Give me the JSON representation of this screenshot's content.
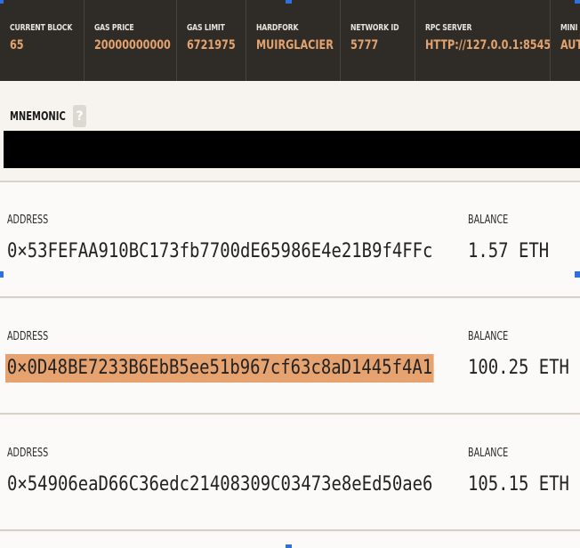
{
  "statusbar": {
    "items": [
      {
        "label": "CURRENT BLOCK",
        "value": "65"
      },
      {
        "label": "GAS PRICE",
        "value": "20000000000"
      },
      {
        "label": "GAS LIMIT",
        "value": "6721975"
      },
      {
        "label": "HARDFORK",
        "value": "MUIRGLACIER"
      },
      {
        "label": "NETWORK ID",
        "value": "5777"
      },
      {
        "label": "RPC SERVER",
        "value": "HTTP://127.0.0.1:8545"
      },
      {
        "label": "MINI",
        "value": "AUT"
      }
    ]
  },
  "mnemonic": {
    "label": "MNEMONIC",
    "help_icon": "?"
  },
  "accounts": [
    {
      "address_label": "ADDRESS",
      "address": "0×53FEFAA910BC173fb7700dE65986E4e21B9f4FFc",
      "balance_label": "BALANCE",
      "balance": "1.57 ETH"
    },
    {
      "address_label": "ADDRESS",
      "address": "0×0D48BE7233B6EbB5ee51b967cf63c8aD1445f4A1",
      "balance_label": "BALANCE",
      "balance": "100.25 ETH"
    },
    {
      "address_label": "ADDRESS",
      "address": "0×54906eaD66C36edc21408309C03473e8eEd50ae6",
      "balance_label": "BALANCE",
      "balance": "105.15 ETH"
    }
  ],
  "colors": {
    "header_bg": "#2f2c28",
    "accent": "#e4a36e",
    "highlight": "#e7a36f",
    "selection_handle": "#2f6fe0"
  }
}
